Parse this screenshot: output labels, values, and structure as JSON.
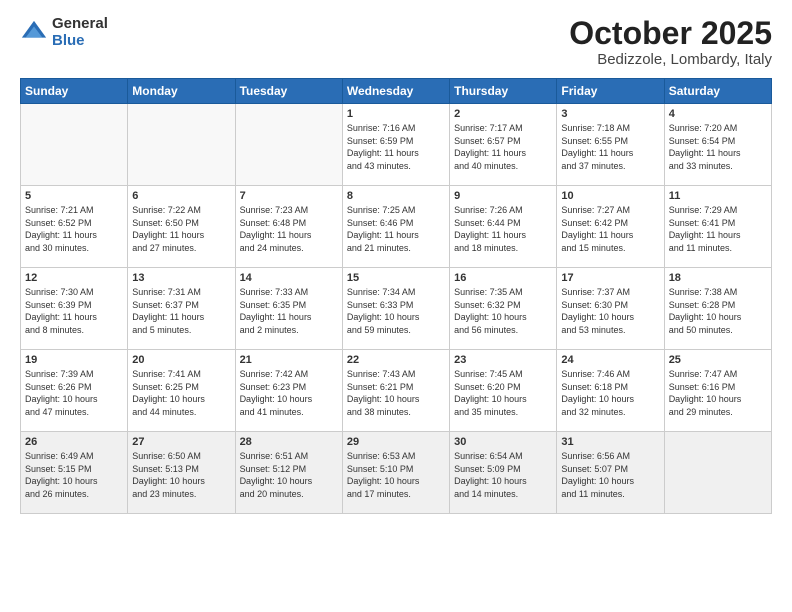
{
  "logo": {
    "general": "General",
    "blue": "Blue"
  },
  "title": {
    "month": "October 2025",
    "location": "Bedizzole, Lombardy, Italy"
  },
  "weekdays": [
    "Sunday",
    "Monday",
    "Tuesday",
    "Wednesday",
    "Thursday",
    "Friday",
    "Saturday"
  ],
  "weeks": [
    [
      {
        "day": "",
        "info": ""
      },
      {
        "day": "",
        "info": ""
      },
      {
        "day": "",
        "info": ""
      },
      {
        "day": "1",
        "info": "Sunrise: 7:16 AM\nSunset: 6:59 PM\nDaylight: 11 hours\nand 43 minutes."
      },
      {
        "day": "2",
        "info": "Sunrise: 7:17 AM\nSunset: 6:57 PM\nDaylight: 11 hours\nand 40 minutes."
      },
      {
        "day": "3",
        "info": "Sunrise: 7:18 AM\nSunset: 6:55 PM\nDaylight: 11 hours\nand 37 minutes."
      },
      {
        "day": "4",
        "info": "Sunrise: 7:20 AM\nSunset: 6:54 PM\nDaylight: 11 hours\nand 33 minutes."
      }
    ],
    [
      {
        "day": "5",
        "info": "Sunrise: 7:21 AM\nSunset: 6:52 PM\nDaylight: 11 hours\nand 30 minutes."
      },
      {
        "day": "6",
        "info": "Sunrise: 7:22 AM\nSunset: 6:50 PM\nDaylight: 11 hours\nand 27 minutes."
      },
      {
        "day": "7",
        "info": "Sunrise: 7:23 AM\nSunset: 6:48 PM\nDaylight: 11 hours\nand 24 minutes."
      },
      {
        "day": "8",
        "info": "Sunrise: 7:25 AM\nSunset: 6:46 PM\nDaylight: 11 hours\nand 21 minutes."
      },
      {
        "day": "9",
        "info": "Sunrise: 7:26 AM\nSunset: 6:44 PM\nDaylight: 11 hours\nand 18 minutes."
      },
      {
        "day": "10",
        "info": "Sunrise: 7:27 AM\nSunset: 6:42 PM\nDaylight: 11 hours\nand 15 minutes."
      },
      {
        "day": "11",
        "info": "Sunrise: 7:29 AM\nSunset: 6:41 PM\nDaylight: 11 hours\nand 11 minutes."
      }
    ],
    [
      {
        "day": "12",
        "info": "Sunrise: 7:30 AM\nSunset: 6:39 PM\nDaylight: 11 hours\nand 8 minutes."
      },
      {
        "day": "13",
        "info": "Sunrise: 7:31 AM\nSunset: 6:37 PM\nDaylight: 11 hours\nand 5 minutes."
      },
      {
        "day": "14",
        "info": "Sunrise: 7:33 AM\nSunset: 6:35 PM\nDaylight: 11 hours\nand 2 minutes."
      },
      {
        "day": "15",
        "info": "Sunrise: 7:34 AM\nSunset: 6:33 PM\nDaylight: 10 hours\nand 59 minutes."
      },
      {
        "day": "16",
        "info": "Sunrise: 7:35 AM\nSunset: 6:32 PM\nDaylight: 10 hours\nand 56 minutes."
      },
      {
        "day": "17",
        "info": "Sunrise: 7:37 AM\nSunset: 6:30 PM\nDaylight: 10 hours\nand 53 minutes."
      },
      {
        "day": "18",
        "info": "Sunrise: 7:38 AM\nSunset: 6:28 PM\nDaylight: 10 hours\nand 50 minutes."
      }
    ],
    [
      {
        "day": "19",
        "info": "Sunrise: 7:39 AM\nSunset: 6:26 PM\nDaylight: 10 hours\nand 47 minutes."
      },
      {
        "day": "20",
        "info": "Sunrise: 7:41 AM\nSunset: 6:25 PM\nDaylight: 10 hours\nand 44 minutes."
      },
      {
        "day": "21",
        "info": "Sunrise: 7:42 AM\nSunset: 6:23 PM\nDaylight: 10 hours\nand 41 minutes."
      },
      {
        "day": "22",
        "info": "Sunrise: 7:43 AM\nSunset: 6:21 PM\nDaylight: 10 hours\nand 38 minutes."
      },
      {
        "day": "23",
        "info": "Sunrise: 7:45 AM\nSunset: 6:20 PM\nDaylight: 10 hours\nand 35 minutes."
      },
      {
        "day": "24",
        "info": "Sunrise: 7:46 AM\nSunset: 6:18 PM\nDaylight: 10 hours\nand 32 minutes."
      },
      {
        "day": "25",
        "info": "Sunrise: 7:47 AM\nSunset: 6:16 PM\nDaylight: 10 hours\nand 29 minutes."
      }
    ],
    [
      {
        "day": "26",
        "info": "Sunrise: 6:49 AM\nSunset: 5:15 PM\nDaylight: 10 hours\nand 26 minutes."
      },
      {
        "day": "27",
        "info": "Sunrise: 6:50 AM\nSunset: 5:13 PM\nDaylight: 10 hours\nand 23 minutes."
      },
      {
        "day": "28",
        "info": "Sunrise: 6:51 AM\nSunset: 5:12 PM\nDaylight: 10 hours\nand 20 minutes."
      },
      {
        "day": "29",
        "info": "Sunrise: 6:53 AM\nSunset: 5:10 PM\nDaylight: 10 hours\nand 17 minutes."
      },
      {
        "day": "30",
        "info": "Sunrise: 6:54 AM\nSunset: 5:09 PM\nDaylight: 10 hours\nand 14 minutes."
      },
      {
        "day": "31",
        "info": "Sunrise: 6:56 AM\nSunset: 5:07 PM\nDaylight: 10 hours\nand 11 minutes."
      },
      {
        "day": "",
        "info": ""
      }
    ]
  ]
}
